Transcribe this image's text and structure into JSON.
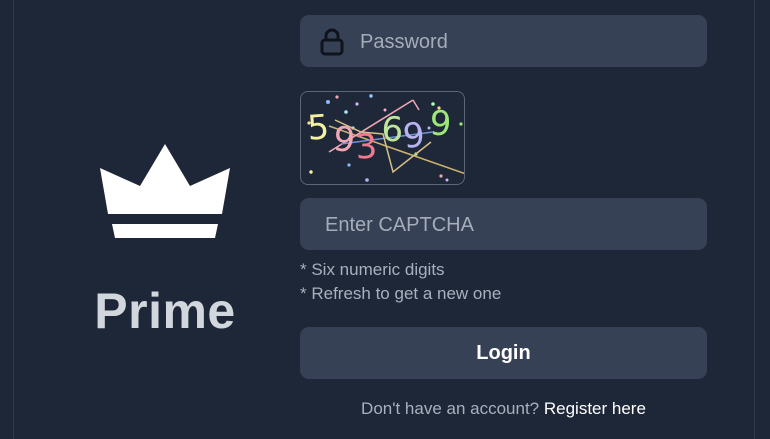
{
  "brand": {
    "name": "Prime",
    "icon": "crown-icon"
  },
  "form": {
    "password": {
      "placeholder": "Password",
      "icon": "lock-icon"
    },
    "captcha": {
      "code": [
        "5",
        "9",
        "3",
        "6",
        "9",
        "9"
      ],
      "digit_colors": [
        "#f4f1a0",
        "#f0a7b5",
        "#f27a8e",
        "#bfe59a",
        "#b9b2f0",
        "#9ee87a"
      ],
      "input_placeholder": "Enter CAPTCHA",
      "hints": [
        "* Six numeric digits",
        "* Refresh to get a new one"
      ]
    },
    "login_label": "Login",
    "register_prompt": "Don't have an account?",
    "register_link": "Register here"
  },
  "colors": {
    "background": "#1e2738",
    "field": "#364155",
    "text_muted": "#a8b0bd",
    "text_strong": "#ffffff"
  }
}
